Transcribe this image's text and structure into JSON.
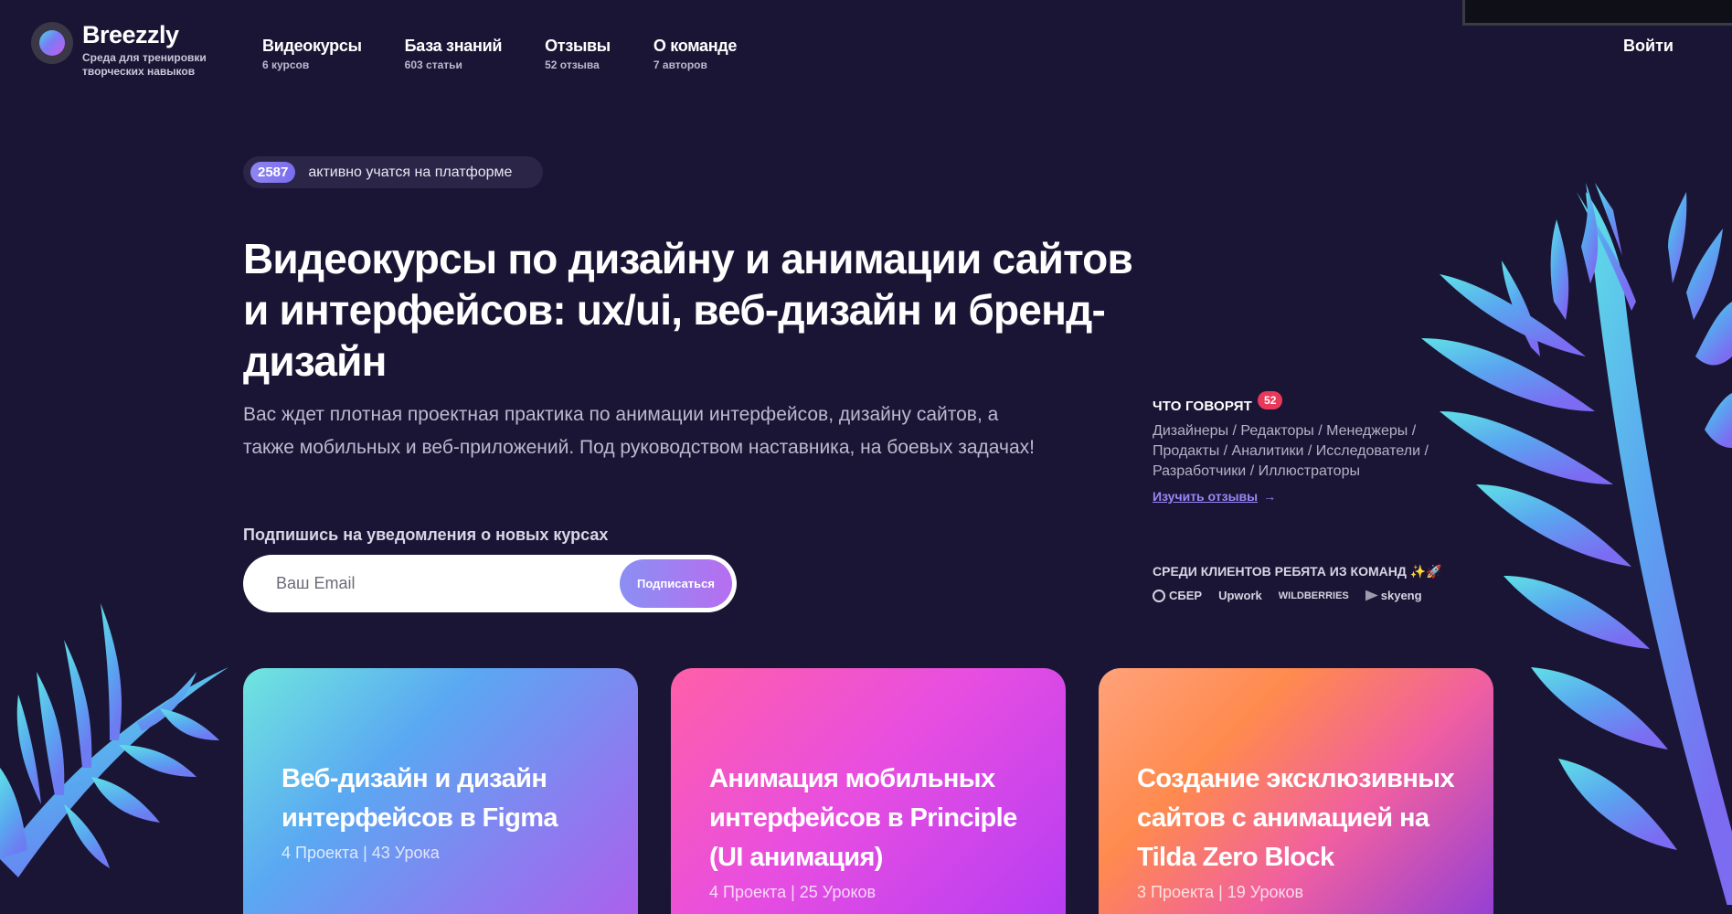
{
  "brand": {
    "name": "Breezzly",
    "tagline": "Среда для тренировки творческих навыков"
  },
  "nav": [
    {
      "label": "Видеокурсы",
      "count": "6 курсов"
    },
    {
      "label": "База знаний",
      "count": "603 статьи"
    },
    {
      "label": "Отзывы",
      "count": "52 отзыва"
    },
    {
      "label": "О команде",
      "count": "7 авторов"
    }
  ],
  "login_label": "Войти",
  "hero": {
    "active_count": "2587",
    "active_text": "активно учатся на платформе",
    "title": "Видеокурсы по дизайну и анимации сайтов и интерфейсов: ux/ui, веб-дизайн и бренд-дизайн",
    "lead": "Вас ждет плотная проектная практика по анимации интерфейсов, дизайну сайтов, а также мобильных и веб-приложений. Под руководством наставника, на боевых задачах!",
    "subscribe_label": "Подпишись на уведомления о новых курсах",
    "email_placeholder": "Ваш Email",
    "subscribe_button": "Подписаться"
  },
  "reviews": {
    "title": "ЧТО ГОВОРЯТ",
    "badge": "52",
    "roles": "Дизайнеры / Редакторы / Менеджеры / Продакты / Аналитики / Исследователи / Разработчики / Иллюстраторы",
    "link": "Изучить отзывы",
    "arrow": "→"
  },
  "clients": {
    "title": "СРЕДИ КЛИЕНТОВ РЕБЯТА ИЗ КОМАНД ✨🚀",
    "logos": [
      "СБЕР",
      "Upwork",
      "WILDBERRIES",
      "skyeng"
    ]
  },
  "courses": [
    {
      "title": "Веб-дизайн и дизайн интерфейсов в Figma",
      "meta": "4 Проекта | 43 Урока"
    },
    {
      "title": "Анимация мобильных интерфейсов в Principle (UI анимация)",
      "meta": "4 Проекта | 25 Уроков"
    },
    {
      "title": "Создание эксклюзивных сайтов с анимацией на Tilda Zero Block",
      "meta": "3 Проекта | 19 Уроков"
    }
  ],
  "colors": {
    "background": "#1b1535",
    "accent": "#9a86f6",
    "badge": "#e8395a"
  }
}
